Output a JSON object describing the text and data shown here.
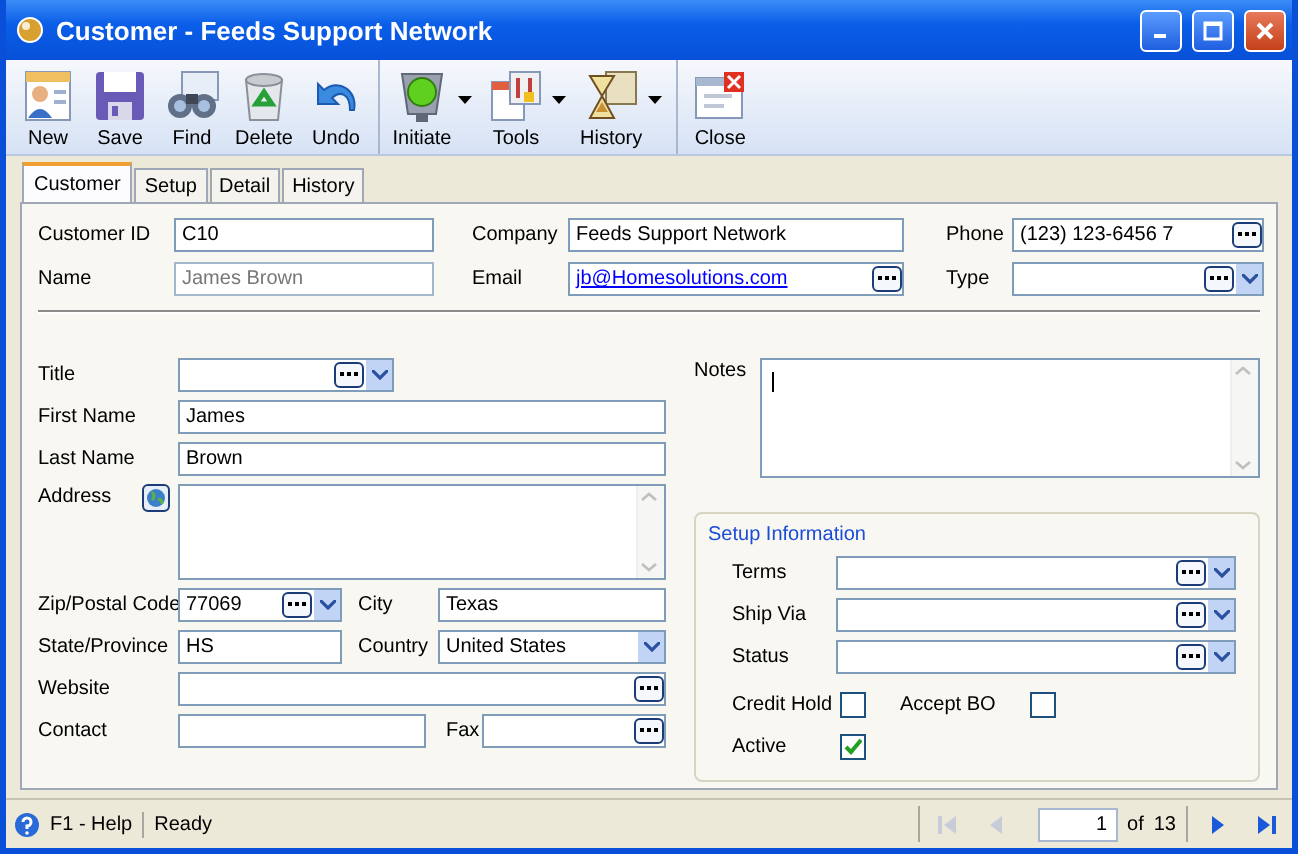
{
  "window": {
    "title": "Customer - Feeds Support Network"
  },
  "toolbar": {
    "groups": [
      [
        {
          "label": "New",
          "kind": "button"
        },
        {
          "label": "Save",
          "kind": "button"
        },
        {
          "label": "Find",
          "kind": "button"
        },
        {
          "label": "Delete",
          "kind": "button"
        },
        {
          "label": "Undo",
          "kind": "button"
        }
      ],
      [
        {
          "label": "Initiate",
          "kind": "split"
        },
        {
          "label": "Tools",
          "kind": "split"
        },
        {
          "label": "History",
          "kind": "split"
        }
      ],
      [
        {
          "label": "Close",
          "kind": "button"
        }
      ]
    ]
  },
  "tabs": [
    {
      "label": "Customer",
      "selected": true
    },
    {
      "label": "Setup",
      "selected": false
    },
    {
      "label": "Detail",
      "selected": false
    },
    {
      "label": "History",
      "selected": false
    }
  ],
  "header_fields": [
    {
      "label": "Customer ID",
      "value": "C10",
      "kind": "text",
      "disabled": false
    },
    {
      "label": "Company",
      "value": "Feeds Support Network",
      "kind": "text",
      "disabled": false
    },
    {
      "label": "Phone",
      "value": "(123) 123-6456 7",
      "kind": "lookup",
      "disabled": false
    },
    {
      "label": "Name",
      "value": "James Brown",
      "kind": "text",
      "disabled": true
    },
    {
      "label": "Email",
      "value": "jb@Homesolutions.com",
      "kind": "email",
      "disabled": false
    },
    {
      "label": "Type",
      "kind": "lookup-combo",
      "disabled": false
    }
  ],
  "left_rows": [
    [
      {
        "label": "Title",
        "kind": "lookup-combo"
      }
    ],
    [
      {
        "label": "First Name",
        "value": "James",
        "kind": "text"
      }
    ],
    [
      {
        "label": "Last Name",
        "value": "Brown",
        "kind": "text"
      }
    ],
    [
      {
        "label": "Address",
        "kind": "memo-map"
      }
    ],
    [
      {
        "label": "Zip/Postal Code",
        "value": "77069",
        "kind": "lookup-combo"
      },
      {
        "label": "City",
        "value": "Texas",
        "kind": "text"
      }
    ],
    [
      {
        "label": "State/Province",
        "value": "HS",
        "kind": "text"
      },
      {
        "label": "Country",
        "value": "United States",
        "kind": "select"
      }
    ],
    [
      {
        "label": "Website",
        "kind": "lookup"
      }
    ],
    [
      {
        "label": "Contact",
        "kind": "text"
      },
      {
        "label": "Fax",
        "kind": "lookup"
      }
    ]
  ],
  "notes": {
    "label": "Notes",
    "kind": "memo"
  },
  "setup_information": {
    "title": "Setup Information",
    "fields": [
      {
        "label": "Terms",
        "kind": "lookup-combo"
      },
      {
        "label": "Ship Via",
        "kind": "lookup-combo"
      },
      {
        "label": "Status",
        "kind": "lookup-combo"
      }
    ],
    "checkboxes": [
      {
        "label": "Credit Hold",
        "checked": false
      },
      {
        "label": "Accept BO",
        "checked": false
      },
      {
        "label": "Active",
        "checked": true
      }
    ]
  },
  "status_bar": {
    "help": "F1 - Help",
    "status": "Ready",
    "page": "1",
    "of": "of",
    "total": "13",
    "nav": [
      {
        "kind": "first",
        "disabled": true
      },
      {
        "kind": "prev",
        "disabled": true
      },
      {
        "kind": "next",
        "disabled": false
      },
      {
        "kind": "last",
        "disabled": false
      }
    ]
  }
}
